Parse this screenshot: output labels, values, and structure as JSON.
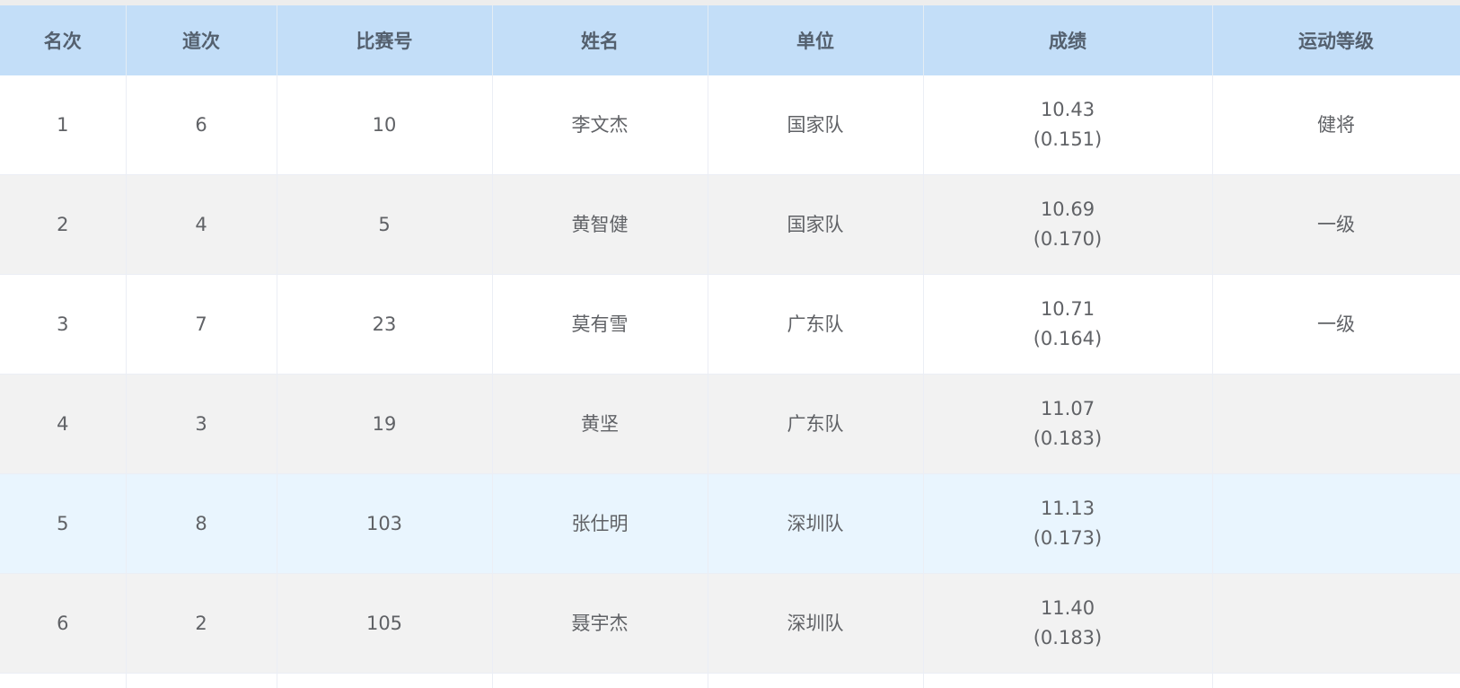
{
  "table": {
    "headers": [
      "名次",
      "道次",
      "比赛号",
      "姓名",
      "单位",
      "成绩",
      "运动等级"
    ],
    "rows": [
      {
        "rank": "1",
        "lane": "6",
        "bib": "10",
        "name": "李文杰",
        "unit": "国家队",
        "time": "10.43",
        "reaction": "(0.151)",
        "grade": "健将"
      },
      {
        "rank": "2",
        "lane": "4",
        "bib": "5",
        "name": "黄智健",
        "unit": "国家队",
        "time": "10.69",
        "reaction": "(0.170)",
        "grade": "一级"
      },
      {
        "rank": "3",
        "lane": "7",
        "bib": "23",
        "name": "莫有雪",
        "unit": "广东队",
        "time": "10.71",
        "reaction": "(0.164)",
        "grade": "一级"
      },
      {
        "rank": "4",
        "lane": "3",
        "bib": "19",
        "name": "黄坚",
        "unit": "广东队",
        "time": "11.07",
        "reaction": "(0.183)",
        "grade": ""
      },
      {
        "rank": "5",
        "lane": "8",
        "bib": "103",
        "name": "张仕明",
        "unit": "深圳队",
        "time": "11.13",
        "reaction": "(0.173)",
        "grade": ""
      },
      {
        "rank": "6",
        "lane": "2",
        "bib": "105",
        "name": "聂宇杰",
        "unit": "深圳队",
        "time": "11.40",
        "reaction": "(0.183)",
        "grade": ""
      }
    ]
  },
  "colors": {
    "header_bg": "#c3def8",
    "row_alt_bg": "#f2f2f2",
    "row_hover_bg": "#e9f5fe",
    "text": "#606266"
  }
}
